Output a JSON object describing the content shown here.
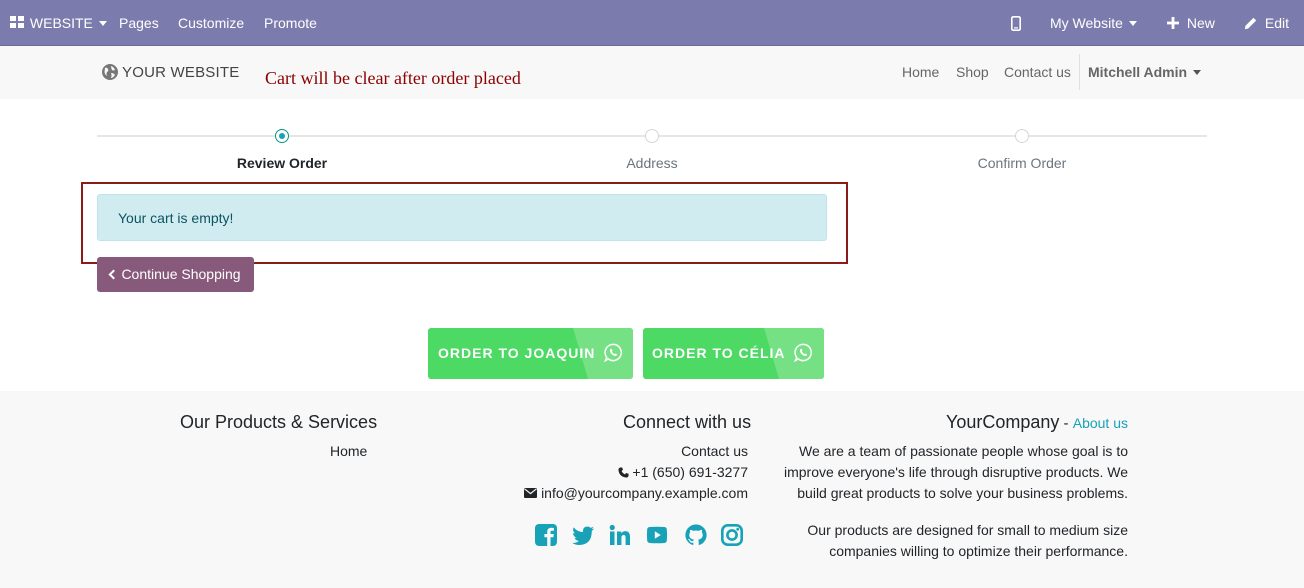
{
  "adminbar": {
    "website_label": "WEBSITE",
    "pages_label": "Pages",
    "customize_label": "Customize",
    "promote_label": "Promote",
    "my_website_label": "My Website",
    "new_label": "New",
    "edit_label": "Edit"
  },
  "header": {
    "logo_text": "YOUR WEBSITE",
    "annotation": "Cart will be clear after order placed",
    "nav": {
      "home": "Home",
      "shop": "Shop",
      "contact": "Contact us",
      "user": "Mitchell Admin"
    }
  },
  "wizard": {
    "steps": [
      {
        "label": "Review Order",
        "active": true
      },
      {
        "label": "Address",
        "active": false
      },
      {
        "label": "Confirm Order",
        "active": false
      }
    ]
  },
  "cart": {
    "empty_message": "Your cart is empty!",
    "continue_label": "Continue Shopping"
  },
  "whatsapp": {
    "buttons": [
      {
        "label": "ORDER TO JOAQUIN"
      },
      {
        "label": "ORDER TO CÉLIA"
      }
    ]
  },
  "footer": {
    "products": {
      "heading": "Our Products & Services",
      "home_link": "Home"
    },
    "connect": {
      "heading": "Connect with us",
      "contact_link": "Contact us",
      "phone": "+1 (650) 691-3277",
      "email": "info@yourcompany.example.com"
    },
    "about": {
      "company": "YourCompany",
      "separator": " - ",
      "about_link": "About us",
      "paragraph1_lines": [
        "We are a team of passionate people whose goal is to",
        "improve everyone's life through disruptive products. We",
        "build great products to solve your business problems."
      ],
      "paragraph2_lines": [
        "Our products are designed for small to medium size",
        "companies willing to optimize their performance."
      ]
    },
    "social_icons": [
      "facebook-icon",
      "twitter-icon",
      "linkedin-icon",
      "youtube-icon",
      "github-icon",
      "instagram-icon"
    ]
  },
  "colors": {
    "adminbar": "#7c7bad",
    "primary": "#875a7b",
    "accent": "#17a2b8",
    "whatsapp": "#4cd964",
    "annotation": "#8b0000"
  }
}
